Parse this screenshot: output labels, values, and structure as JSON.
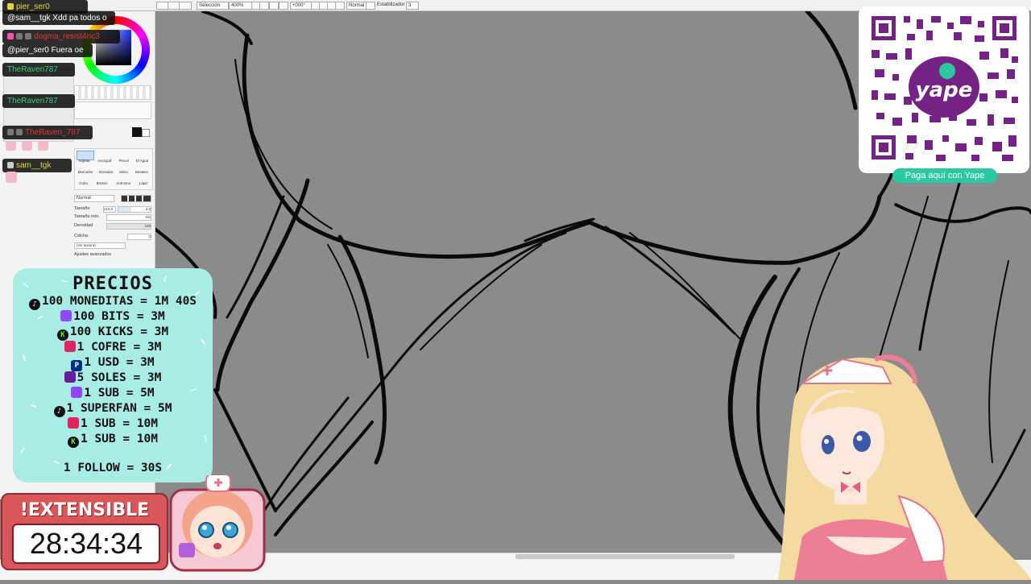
{
  "toolbar": {
    "selection_label": "Selección",
    "zoom": "400%",
    "rotation": "+000°",
    "blend_mode": "Normal",
    "stabilizer_label": "Estabilizador",
    "stabilizer_value": "3"
  },
  "chat": [
    {
      "user": "pier_ser0",
      "message": "",
      "style": "user-yellow"
    },
    {
      "user": "",
      "message": "@sam__tgk Xdd pa todos o",
      "style": "plain"
    },
    {
      "user": "dogma_resist4nc3",
      "message": "",
      "style": "user-red"
    },
    {
      "user": "",
      "message": "@pier_ser0 Fuera oe",
      "style": "plain"
    },
    {
      "user": "TheRaven787",
      "message": "",
      "style": "user-green"
    },
    {
      "user": "TheRaven787",
      "message": "",
      "style": "user-green"
    },
    {
      "user": "TheRaven_787",
      "message": "",
      "style": "user-red"
    },
    {
      "user": "sam__tgk",
      "message": "",
      "style": "user-yellow"
    }
  ],
  "tool_panel": {
    "tool_names": [
      "Sujetar",
      "Aerógraf",
      "Pincel",
      "El Agua"
    ],
    "tool_names_2": [
      "Marcador",
      "Borrador",
      "Selec.",
      "Deselec."
    ],
    "tool_names_3": [
      "Cubo",
      "Binario",
      "Anti-tono",
      "Lápiz"
    ],
    "mode": "Normal",
    "size_label": "Tamaño",
    "size_multiplier": "x10.0",
    "size_value": "2.5",
    "min_size_label": "Tamaño mín.",
    "min_size_value": "0%",
    "density_label": "Densidad",
    "density_value": "100",
    "texture_label": "Colcha",
    "texture_value": "0",
    "no_texture_label": "(sin textura)",
    "advanced_label": "Ajustes avanzados"
  },
  "prices": {
    "title": "PRECIOS",
    "items": [
      {
        "text": "100 MONEDITAS = 1M 40S",
        "icon": "tiktok-icon",
        "color": "#111111"
      },
      {
        "text": "100 BITS = 3M",
        "icon": "twitch-icon",
        "color": "#9146ff"
      },
      {
        "text": "100 KICKS = 3M",
        "icon": "kick-icon",
        "color": "#53fc18"
      },
      {
        "text": "1 COFRE = 3M",
        "icon": "chest-icon",
        "color": "#e0245e"
      },
      {
        "text": "1 USD = 3M",
        "icon": "paypal-icon",
        "color": "#003087"
      },
      {
        "text": "5 SOLES = 3M",
        "icon": "soles-icon",
        "color": "#6a1b9a"
      },
      {
        "text": "1 SUB = 5M",
        "icon": "twitch-icon",
        "color": "#9146ff"
      },
      {
        "text": "1 SUPERFAN = 5M",
        "icon": "tiktok-icon",
        "color": "#111111"
      },
      {
        "text": "1 SUB = 10M",
        "icon": "chest-icon",
        "color": "#e0245e"
      },
      {
        "text": "1 SUB = 10M",
        "icon": "kick-icon",
        "color": "#53fc18"
      }
    ],
    "follow": "1 FOLLOW = 30S"
  },
  "timer": {
    "label": "!EXTENSIBLE",
    "time": "28:34:34"
  },
  "yape": {
    "button_label": "Paga aquí con Yape",
    "logo_text": "yape",
    "brand_color": "#742284"
  },
  "colors": {
    "prices_bg": "#a9ece5",
    "timer_bg": "#d9575b",
    "yape_button": "#2ac9a2"
  }
}
